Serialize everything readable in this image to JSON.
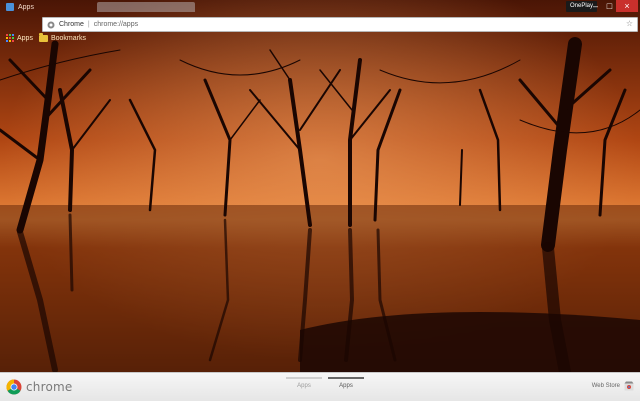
{
  "window": {
    "tab_title": "Apps",
    "profile_name": "OnePlay",
    "minimize_glyph": "–",
    "maximize_glyph": "□",
    "close_glyph": "×"
  },
  "omnibox": {
    "scheme_label": "Chrome",
    "separator": "|",
    "url": "chrome://apps",
    "star_icon": "☆"
  },
  "bookmarks": {
    "items": [
      {
        "label": "Apps",
        "icon": "apps-grid-icon"
      },
      {
        "label": "Bookmarks",
        "icon": "folder-icon"
      }
    ]
  },
  "bottombar": {
    "brand": "chrome",
    "page_tabs": [
      {
        "label": "Apps",
        "active": false
      },
      {
        "label": "Apps",
        "active": true
      }
    ],
    "webstore_label": "Web Store"
  },
  "colors": {
    "sky": "#c0501a",
    "water": "#5a2008",
    "trees": "#1a0602"
  }
}
